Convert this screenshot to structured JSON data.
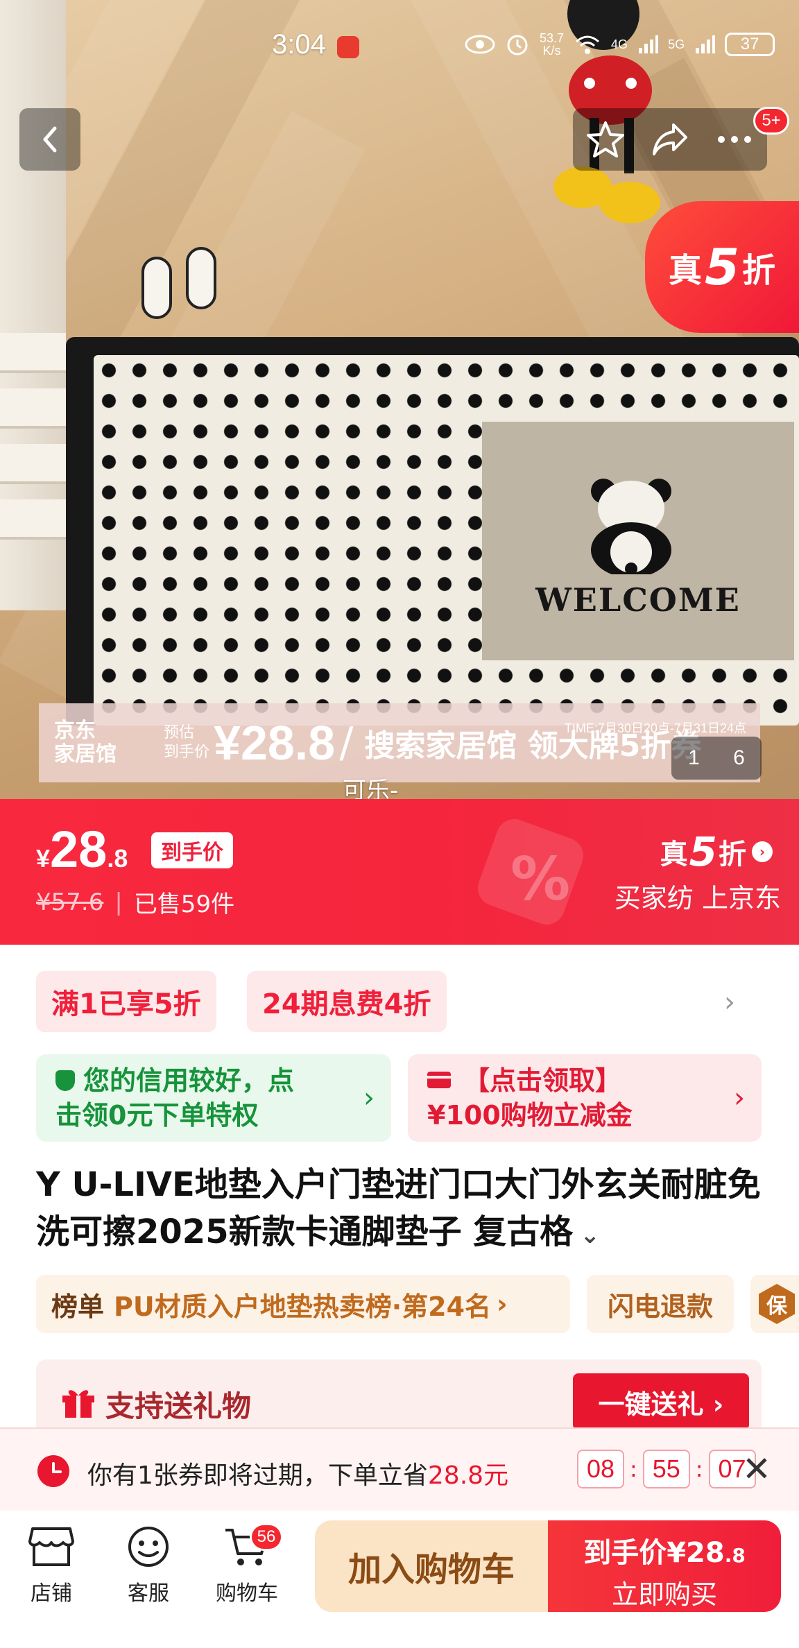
{
  "status_bar": {
    "time": "3:04",
    "net_speed_value": "53.7",
    "net_speed_unit": "K/s",
    "signal1": "4G",
    "signal2": "5G",
    "battery": "37"
  },
  "nav": {
    "message_badge": "5+"
  },
  "hero": {
    "discount_prefix": "真",
    "discount_num": "5",
    "discount_suffix": "折",
    "rug_text": "WELCOME",
    "promo_logo_line1": "京东",
    "promo_logo_line2": "家居馆",
    "promo_prefix_line1": "预估",
    "promo_prefix_line2": "到手价",
    "promo_price": "¥28.8",
    "promo_slash": "/",
    "promo_cta": "搜索家居馆 领大牌5折券",
    "promo_time": "TIME:7月30日20点-7月31日24点",
    "image_index": "1",
    "image_total": "6",
    "variant_caption": "可乐-"
  },
  "price": {
    "currency": "¥",
    "integer": "28",
    "decimal": ".8",
    "tag": "到手价",
    "original": "¥57.6",
    "separator": "|",
    "sold": "已售59件",
    "right_prefix": "真",
    "right_num": "5",
    "right_suffix": "折",
    "right_arrow": "›",
    "right_sub": "买家纺 上京东",
    "deco_symbol": "%"
  },
  "chips": {
    "chip1": "满1已享5折",
    "chip2": "24期息费4折",
    "more": "›"
  },
  "credit_card": {
    "line1": "您的信用较好，点",
    "line2": "击领0元下单特权",
    "arrow": "›"
  },
  "coupon_card": {
    "line1": "【点击领取】",
    "line2": "¥100购物立减金",
    "arrow": "›"
  },
  "product": {
    "title": "Y U-LIVE地垫入户门垫进门口大门外玄关耐脏免洗可擦2025新款卡通脚垫子 复古格",
    "chevron": "⌄"
  },
  "rank": {
    "label": "榜单",
    "text": "PU材质入户地垫热卖榜·第24名",
    "arrow": "›",
    "refund": "闪电退款",
    "guarantee_icon_text": "保"
  },
  "gift": {
    "text": "支持送礼物",
    "button": "一键送礼 ›"
  },
  "expiry": {
    "text_before": "你有1张券即将过期，下单立省",
    "amount": "28.8元",
    "h": "08",
    "m": "55",
    "s": "07",
    "colon": ":",
    "close": "✕"
  },
  "bottom": {
    "store": "店铺",
    "service": "客服",
    "cart": "购物车",
    "cart_badge": "56",
    "add_to_cart": "加入购物车",
    "buy_prefix": "到手价",
    "buy_price": "¥28",
    "buy_decimal": ".8",
    "buy_now": "立即购买"
  },
  "colors": {
    "brand_red": "#f01f3a",
    "price_bar": "#f5253d",
    "add_cart_bg": "#fbe3c6",
    "credit_green": "#16933b"
  }
}
